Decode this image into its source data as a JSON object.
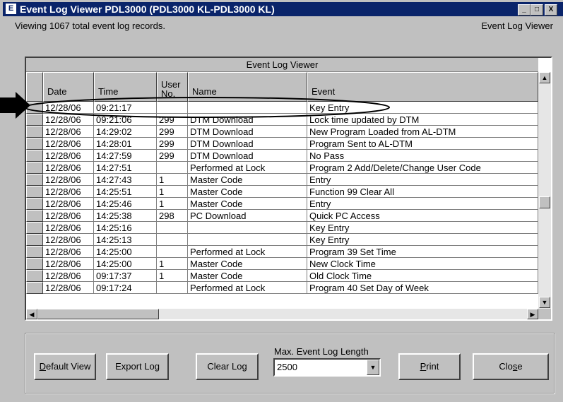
{
  "window": {
    "title": "Event Log Viewer PDL3000 (PDL3000 KL-PDL3000 KL)",
    "app_icon": "event-log-app-icon",
    "minimize": "_",
    "maximize": "□",
    "close": "X"
  },
  "status": {
    "left": "Viewing 1067 total event log records.",
    "right": "Event Log Viewer"
  },
  "grid": {
    "caption": "Event Log Viewer",
    "columns": [
      "Date",
      "Time",
      "User No.",
      "Name",
      "Event"
    ],
    "rows": [
      [
        "12/28/06",
        "09:21:17",
        "",
        "",
        "Key Entry"
      ],
      [
        "12/28/06",
        "09:21:06",
        "299",
        "DTM Download",
        "Lock time updated by DTM"
      ],
      [
        "12/28/06",
        "14:29:02",
        "299",
        "DTM Download",
        "New Program Loaded from AL-DTM"
      ],
      [
        "12/28/06",
        "14:28:01",
        "299",
        "DTM Download",
        "Program Sent to AL-DTM"
      ],
      [
        "12/28/06",
        "14:27:59",
        "299",
        "DTM Download",
        "No Pass"
      ],
      [
        "12/28/06",
        "14:27:51",
        "",
        "Performed at Lock",
        "Program 2 Add/Delete/Change User Code"
      ],
      [
        "12/28/06",
        "14:27:43",
        "1",
        "Master Code",
        "Entry"
      ],
      [
        "12/28/06",
        "14:25:51",
        "1",
        "Master Code",
        "Function 99 Clear All"
      ],
      [
        "12/28/06",
        "14:25:46",
        "1",
        "Master Code",
        "Entry"
      ],
      [
        "12/28/06",
        "14:25:38",
        "298",
        "PC Download",
        "Quick PC Access"
      ],
      [
        "12/28/06",
        "14:25:16",
        "",
        "",
        "Key Entry"
      ],
      [
        "12/28/06",
        "14:25:13",
        "",
        "",
        "Key Entry"
      ],
      [
        "12/28/06",
        "14:25:00",
        "",
        "Performed at Lock",
        "Program 39 Set Time"
      ],
      [
        "12/28/06",
        "14:25:00",
        "1",
        "Master Code",
        "New Clock Time"
      ],
      [
        "12/28/06",
        "09:17:37",
        "1",
        "Master Code",
        "Old Clock Time"
      ],
      [
        "12/28/06",
        "09:17:24",
        "",
        "Performed at Lock",
        "Program 40 Set Day of Week"
      ]
    ]
  },
  "controls": {
    "default_view_prefix": "D",
    "default_view_rest": "efault View",
    "export_log": "Export Log",
    "clear_log": "Clear Log",
    "max_length_label": "Max. Event Log  Length",
    "max_length_value": "2500",
    "print_prefix": "P",
    "print_rest": "rint",
    "close_prefix": "Clo",
    "close_ul": "s",
    "close_rest": "e"
  },
  "colors": {
    "title_bar": "#0a246a",
    "face": "#c0c0c0",
    "annotation": "#000000"
  },
  "annotation": {
    "arrow": "right-pointing-arrow",
    "oval": "highlight-oval"
  }
}
